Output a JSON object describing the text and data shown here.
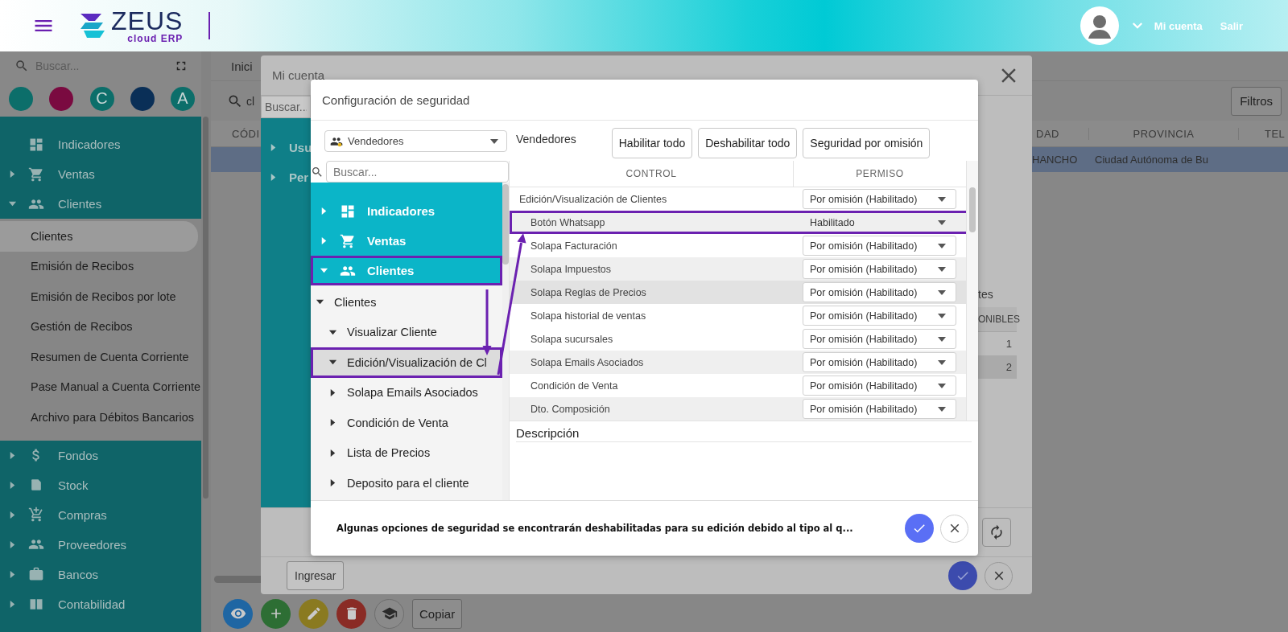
{
  "header": {
    "logo": {
      "name": "ZEUS",
      "tagline": "cloud ERP"
    },
    "account_link": "Mi cuenta",
    "logout_link": "Salir"
  },
  "sidebar": {
    "search": {
      "placeholder": "Buscar..."
    },
    "shortcuts": [
      {
        "color": "#0c6e6a"
      },
      {
        "color": "#7a0a40"
      },
      {
        "color": "#0c6e6a",
        "label": "C"
      },
      {
        "color": "#0a2f57"
      },
      {
        "color": "#0c6e6a",
        "label": "A"
      }
    ],
    "menu": [
      {
        "label": "Indicadores"
      },
      {
        "label": "Ventas",
        "expanded": false
      },
      {
        "label": "Clientes",
        "expanded": true,
        "children": [
          {
            "label": "Clientes",
            "selected": true
          },
          {
            "label": "Emisión de Recibos",
            "selected": false
          },
          {
            "label": "Emisión de Recibos por lote",
            "selected": false
          },
          {
            "label": "Gestión de Recibos",
            "selected": false
          },
          {
            "label": "Resumen de Cuenta Corriente",
            "selected": false
          },
          {
            "label": "Pase Manual a Cuenta Corriente",
            "selected": false
          },
          {
            "label": "Archivo para Débitos Bancarios",
            "selected": false
          }
        ]
      },
      {
        "label": "Fondos",
        "expanded": false
      },
      {
        "label": "Stock",
        "expanded": false
      },
      {
        "label": "Compras",
        "expanded": false
      },
      {
        "label": "Proveedores",
        "expanded": false
      },
      {
        "label": "Bancos",
        "expanded": false
      },
      {
        "label": "Contabilidad",
        "expanded": false
      }
    ]
  },
  "main": {
    "tab": "Inici",
    "search": {
      "value": "cl"
    },
    "filter_button": "Filtros",
    "table": {
      "columns": [
        "CÓDI",
        "DAD",
        "PROVINCIA",
        "TEL"
      ],
      "rows": [
        {
          "cells": [
            "",
            "HANCHO",
            "Ciudad Autónoma de Bu"
          ],
          "selected": true
        }
      ]
    },
    "toolbar": {
      "copy_button": "Copiar"
    }
  },
  "account_dialog": {
    "title": "Mi cuenta",
    "search": {
      "placeholder": "Buscar..."
    },
    "tree": [
      {
        "label": "Usu",
        "expanded": false
      },
      {
        "label": "Per",
        "expanded": false
      }
    ],
    "side_text": "tes",
    "table": {
      "columns": [
        "ONIBLES"
      ],
      "rows": [
        {
          "cells": [
            "1"
          ],
          "selected": false
        },
        {
          "cells": [
            "2"
          ],
          "selected": true
        }
      ]
    },
    "submit_button": "Ingresar"
  },
  "security_dialog": {
    "title": "Configuración de seguridad",
    "role_select": {
      "value": "Vendedores"
    },
    "role_label": "Vendedores",
    "buttons": [
      "Habilitar todo",
      "Deshabilitar todo",
      "Seguridad por omisión"
    ],
    "search": {
      "placeholder": "Buscar..."
    },
    "tree": [
      {
        "label": "Indicadores",
        "expanded": false,
        "annotated": false
      },
      {
        "label": "Ventas",
        "expanded": false,
        "annotated": false
      },
      {
        "label": "Clientes",
        "expanded": true,
        "annotated": true,
        "children": [
          {
            "label": "Clientes",
            "expanded": true,
            "children": [
              {
                "label": "Visualizar Cliente",
                "expanded": true,
                "selected": false,
                "annotated": false
              },
              {
                "label": "Edición/Visualización de Cl",
                "expanded": true,
                "selected": true,
                "annotated": true
              },
              {
                "label": "Solapa Emails Asociados",
                "expanded": false,
                "selected": false,
                "annotated": false
              },
              {
                "label": "Condición de Venta",
                "expanded": false,
                "selected": false,
                "annotated": false
              },
              {
                "label": "Lista de Precios",
                "expanded": false,
                "selected": false,
                "annotated": false
              },
              {
                "label": "Deposito para el cliente",
                "expanded": false,
                "selected": false,
                "annotated": false
              }
            ]
          }
        ]
      }
    ],
    "table": {
      "columns": [
        "CONTROL",
        "PERMISO"
      ],
      "rows": [
        {
          "control": "Edición/Visualización de Clientes",
          "permission": "Por omisión (Habilitado)",
          "shaded": false,
          "selected": false,
          "annotated": false,
          "children": [
            {
              "control": "Botón Whatsapp",
              "permission": "Habilitado",
              "shaded": true,
              "selected": false,
              "annotated": true
            },
            {
              "control": "Solapa Facturación",
              "permission": "Por omisión (Habilitado)",
              "shaded": false,
              "selected": false,
              "annotated": false
            },
            {
              "control": "Solapa Impuestos",
              "permission": "Por omisión (Habilitado)",
              "shaded": true,
              "selected": false,
              "annotated": false
            },
            {
              "control": "Solapa Reglas de Precios",
              "permission": "Por omisión (Habilitado)",
              "shaded": false,
              "selected": true,
              "annotated": false
            },
            {
              "control": "Solapa historial de ventas",
              "permission": "Por omisión (Habilitado)",
              "shaded": false,
              "selected": false,
              "annotated": false
            },
            {
              "control": "Solapa sucursales",
              "permission": "Por omisión (Habilitado)",
              "shaded": false,
              "selected": false,
              "annotated": false
            },
            {
              "control": "Solapa Emails Asociados",
              "permission": "Por omisión (Habilitado)",
              "shaded": true,
              "selected": false,
              "annotated": false
            },
            {
              "control": "Condición de Venta",
              "permission": "Por omisión (Habilitado)",
              "shaded": false,
              "selected": false,
              "annotated": false
            },
            {
              "control": "Dto. Composición",
              "permission": "Por omisión (Habilitado)",
              "shaded": true,
              "selected": false,
              "annotated": false
            }
          ]
        }
      ]
    },
    "description_label": "Descripción",
    "message": "Algunas opciones de seguridad se encontrarán deshabilitadas para su edición debido al tipo al q..."
  }
}
